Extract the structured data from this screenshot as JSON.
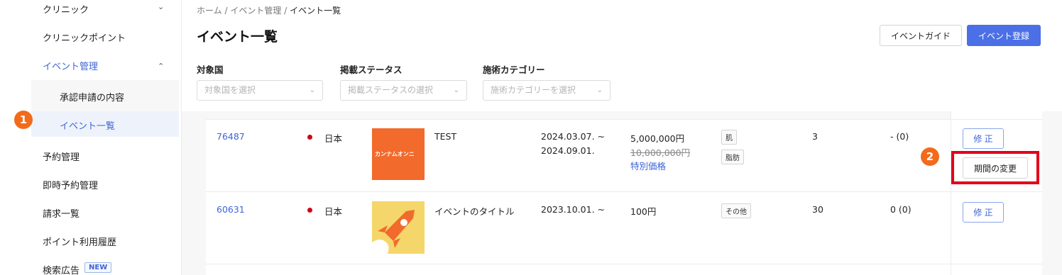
{
  "sidebar": {
    "clinic": "クリニック",
    "clinic_points": "クリニックポイント",
    "event_mgmt": "イベント管理",
    "approval": "承認申請の内容",
    "event_list": "イベント一覧",
    "reservation": "予約管理",
    "instant_reservation": "即時予約管理",
    "billing": "請求一覧",
    "point_history": "ポイント利用履歴",
    "search_ads": "検索広告",
    "new_badge": "NEW"
  },
  "markers": {
    "one": "1",
    "two": "2"
  },
  "breadcrumb": {
    "home": "ホーム",
    "sep": "/",
    "event_mgmt": "イベント管理",
    "current": "イベント一覧"
  },
  "page_title": "イベント一覧",
  "buttons": {
    "guide": "イベントガイド",
    "register": "イベント登録",
    "edit": "修 正",
    "change_period": "期間の変更"
  },
  "filters": {
    "country": {
      "label": "対象国",
      "placeholder": "対象国を選択"
    },
    "status": {
      "label": "掲載ステータス",
      "placeholder": "掲載ステータスの選択"
    },
    "category": {
      "label": "施術カテゴリー",
      "placeholder": "施術カテゴリーを選択"
    }
  },
  "rows": [
    {
      "id": "76487",
      "country": "日本",
      "thumb_logo": "カンナムオンニ",
      "title": "TEST",
      "period_start": "2024.03.07. ~",
      "period_end": "2024.09.01.",
      "price": "5,000,000円",
      "original_price": "10,000,000円",
      "special": "特別価格",
      "tags": [
        "肌",
        "脂肪"
      ],
      "count": "3",
      "reviews": "- (0)"
    },
    {
      "id": "60631",
      "country": "日本",
      "title": "イベントのタイトル",
      "period_start": "2023.10.01. ~",
      "price": "100円",
      "tags": [
        "その他"
      ],
      "count": "30",
      "reviews": "0 (0)"
    }
  ],
  "colors": {
    "accent": "#4b6fe6",
    "marker": "#f26a1b",
    "highlight": "#e3001b",
    "thumb1": "#f26a2c",
    "thumb2": "#f5d66a"
  }
}
